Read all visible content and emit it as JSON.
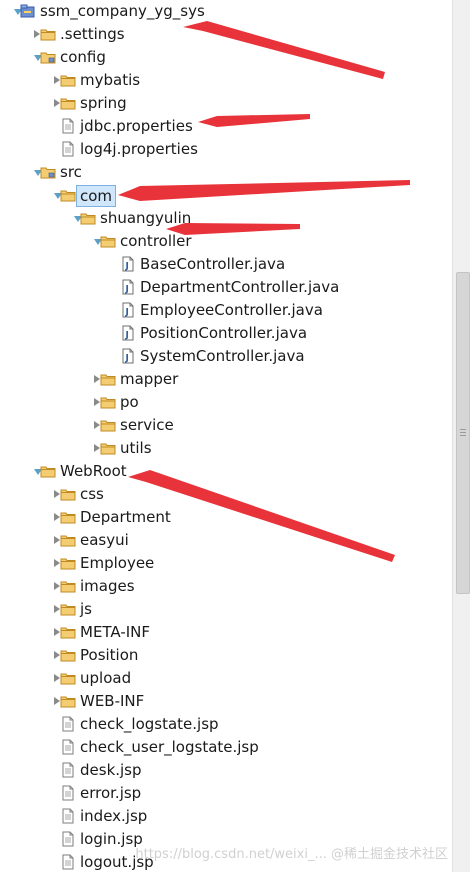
{
  "tree": {
    "items": [
      {
        "label": "ssm_company_yg_sys",
        "icon": "project-icon",
        "toggle": "expanded",
        "arrow": true
      },
      {
        "label": ".settings",
        "icon": "folder-icon",
        "toggle": "collapsed"
      },
      {
        "label": "config",
        "icon": "source-folder-icon",
        "toggle": "expanded"
      },
      {
        "label": "mybatis",
        "icon": "folder-icon",
        "toggle": "collapsed"
      },
      {
        "label": "spring",
        "icon": "folder-icon",
        "toggle": "collapsed"
      },
      {
        "label": "jdbc.properties",
        "icon": "properties-file-icon",
        "toggle": "none"
      },
      {
        "label": "log4j.properties",
        "icon": "properties-file-icon",
        "toggle": "none"
      },
      {
        "label": "src",
        "icon": "source-folder-icon",
        "toggle": "expanded"
      },
      {
        "label": "com",
        "icon": "package-folder-icon",
        "toggle": "expanded",
        "selected": true
      },
      {
        "label": "shuangyulin",
        "icon": "package-folder-icon",
        "toggle": "expanded"
      },
      {
        "label": "controller",
        "icon": "package-folder-icon",
        "toggle": "expanded"
      },
      {
        "label": "BaseController.java",
        "icon": "java-file-icon",
        "toggle": "none"
      },
      {
        "label": "DepartmentController.java",
        "icon": "java-file-icon",
        "toggle": "none"
      },
      {
        "label": "EmployeeController.java",
        "icon": "java-file-icon",
        "toggle": "none"
      },
      {
        "label": "PositionController.java",
        "icon": "java-file-icon",
        "toggle": "none"
      },
      {
        "label": "SystemController.java",
        "icon": "java-file-icon",
        "toggle": "none"
      },
      {
        "label": "mapper",
        "icon": "package-folder-icon",
        "toggle": "collapsed"
      },
      {
        "label": "po",
        "icon": "package-folder-icon",
        "toggle": "collapsed"
      },
      {
        "label": "service",
        "icon": "package-folder-icon",
        "toggle": "collapsed"
      },
      {
        "label": "utils",
        "icon": "package-folder-icon",
        "toggle": "collapsed"
      },
      {
        "label": "WebRoot",
        "icon": "folder-icon",
        "toggle": "expanded"
      },
      {
        "label": "css",
        "icon": "folder-icon",
        "toggle": "collapsed"
      },
      {
        "label": "Department",
        "icon": "folder-icon",
        "toggle": "collapsed"
      },
      {
        "label": "easyui",
        "icon": "folder-icon",
        "toggle": "collapsed"
      },
      {
        "label": "Employee",
        "icon": "folder-icon",
        "toggle": "collapsed"
      },
      {
        "label": "images",
        "icon": "folder-icon",
        "toggle": "collapsed"
      },
      {
        "label": "js",
        "icon": "folder-icon",
        "toggle": "collapsed"
      },
      {
        "label": "META-INF",
        "icon": "folder-icon",
        "toggle": "collapsed"
      },
      {
        "label": "Position",
        "icon": "folder-icon",
        "toggle": "collapsed"
      },
      {
        "label": "upload",
        "icon": "folder-icon",
        "toggle": "collapsed"
      },
      {
        "label": "WEB-INF",
        "icon": "folder-icon",
        "toggle": "collapsed"
      },
      {
        "label": "check_logstate.jsp",
        "icon": "jsp-file-icon",
        "toggle": "none"
      },
      {
        "label": "check_user_logstate.jsp",
        "icon": "jsp-file-icon",
        "toggle": "none"
      },
      {
        "label": "desk.jsp",
        "icon": "jsp-file-icon",
        "toggle": "none"
      },
      {
        "label": "error.jsp",
        "icon": "jsp-file-icon",
        "toggle": "none"
      },
      {
        "label": "index.jsp",
        "icon": "jsp-file-icon",
        "toggle": "none"
      },
      {
        "label": "login.jsp",
        "icon": "jsp-file-icon",
        "toggle": "none"
      },
      {
        "label": "logout.jsp",
        "icon": "jsp-file-icon",
        "toggle": "none"
      }
    ]
  },
  "watermark": "https://blog.csdn.net/weixi_... @稀土掘金技术社区",
  "colors": {
    "arrow": "#e8333a",
    "folder": "#e8b54a",
    "selection": "#cfe6fb"
  }
}
